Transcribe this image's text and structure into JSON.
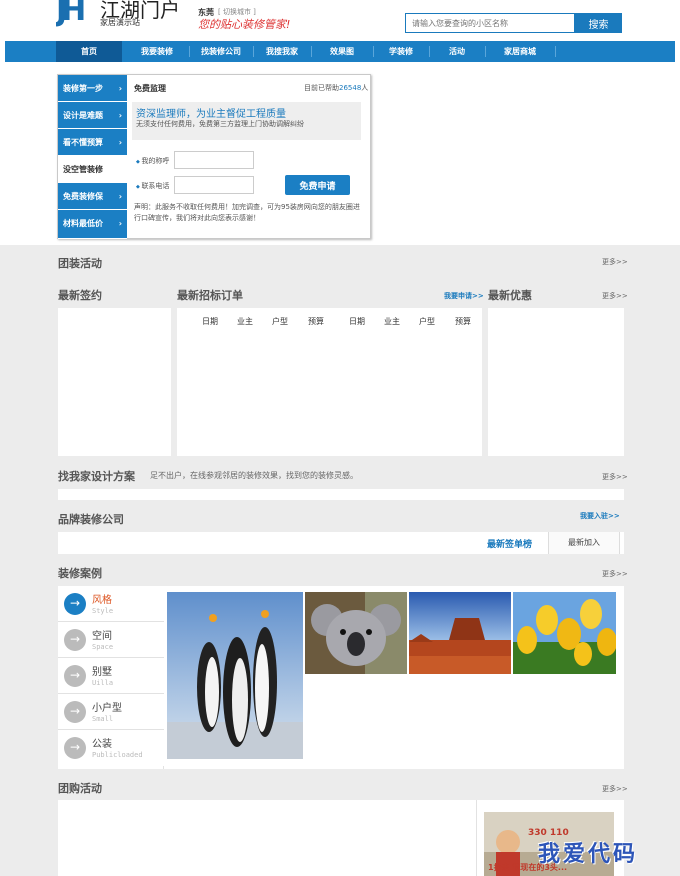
{
  "header": {
    "logo_mark": "JH",
    "logo_text": "江湖门户",
    "logo_sub": "家居演示站",
    "city": "东莞",
    "city_switch": "[ 切换城市 ]",
    "slogan": "您的贴心装修管家!",
    "search_placeholder": "请输入您要查询的小区名称",
    "search_button": "搜索"
  },
  "nav": [
    "首页",
    "我要装修",
    "找装修公司",
    "我搜我家",
    "效果图",
    "学装修",
    "活动",
    "家居商城"
  ],
  "sidebar": [
    "装修第一步",
    "设计是难题",
    "看不懂预算",
    "没空管装修",
    "免费装修保",
    "材料最低价"
  ],
  "supervision": {
    "title": "免费监理",
    "help_prefix": "目前已帮助",
    "help_count": "26548",
    "help_suffix": "人",
    "headline": "资深监理师，为业主督促工程质量",
    "note": "无须支付任何费用，免费第三方监理上门协助调解纠纷",
    "label_name": "我的称呼",
    "label_phone": "联系电话",
    "apply_button": "免费申请",
    "disclaimer": "声明：此服务不收取任何费用！加完调查，可为95装房网向您的朋友圈进行口碑宣传，我们将对此向您表示感谢！"
  },
  "sections": {
    "group_activity": "团装活动",
    "more": "更多>>",
    "latest_sign": "最新签约",
    "latest_bid": "最新招标订单",
    "apply_link": "我要申请>>",
    "latest_offer": "最新优惠",
    "bid_columns": [
      "日期",
      "业主",
      "户型",
      "预算",
      "日期",
      "业主",
      "户型",
      "预算"
    ],
    "designer_title": "找我家设计方案",
    "designer_desc": "足不出户，在线参观邻居的装修效果，找到您的装修灵感。",
    "brand_title": "品牌装修公司",
    "join_link": "我要入驻>>",
    "tab_sign_rank": "最新签单榜",
    "tab_new_join": "最新加入",
    "cases_title": "装修案例",
    "group_buy": "团购活动"
  },
  "cases": [
    {
      "name": "风格",
      "en": "Style"
    },
    {
      "name": "空间",
      "en": "Space"
    },
    {
      "name": "别墅",
      "en": "Uilla"
    },
    {
      "name": "小户型",
      "en": "Small"
    },
    {
      "name": "公装",
      "en": "Publicloaded"
    }
  ],
  "ad": {
    "price": "330 110",
    "caption": "1折去 我现在的3头..."
  },
  "watermark": "我爱代码",
  "colors": {
    "brand_blue": "#1b7fc4",
    "accent_red": "#d52222"
  }
}
